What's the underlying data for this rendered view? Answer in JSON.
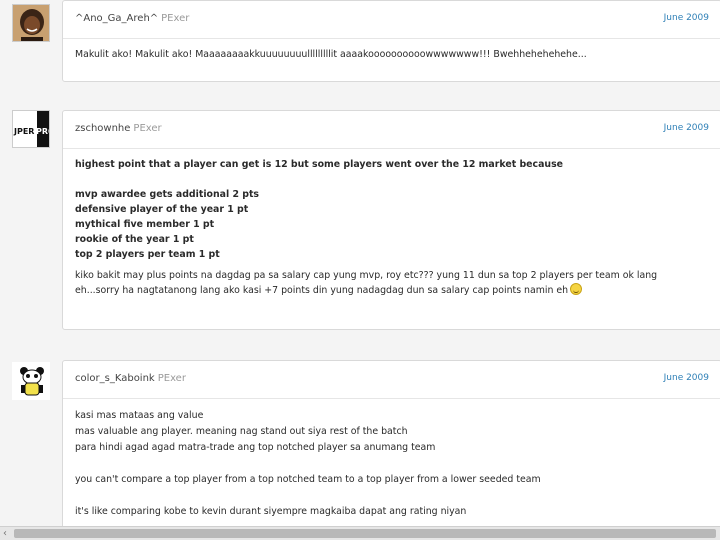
{
  "posts": [
    {
      "username": "^Ano_Ga_Areh^",
      "role": "PExer",
      "date": "June 2009",
      "avatar_icon": "user-photo-icon",
      "lines": [
        "Makulit ako! Makulit ako! Maaaaaaaakkuuuuuuuulllllllllit aaaakoooooooooowwwwwww!!! Bwehhehehehehe..."
      ]
    },
    {
      "username": "zschownhe",
      "role": "PExer",
      "date": "June 2009",
      "avatar_icon": "jperprox-logo-icon",
      "avatar_text": "JPERPROX",
      "bold_lines": [
        "highest point that a player can get is 12 but some players went over the 12 market because",
        "",
        "mvp awardee gets additional 2 pts",
        "defensive player of the year 1 pt",
        "mythical five member 1 pt",
        "rookie of the year 1 pt",
        "top 2 players per team 1 pt"
      ],
      "lines": [
        "kiko bakit may plus points na dagdag pa sa salary cap yung mvp, roy etc??? yung 11 dun sa top 2 players per team ok lang",
        "eh...sorry ha nagtatanong lang ako kasi +7 points din yung nadagdag dun sa salary cap points namin eh"
      ],
      "smiley_icon": "smiley-icon"
    },
    {
      "username": "color_s_Kaboink",
      "role": "PExer",
      "date": "June 2009",
      "avatar_icon": "panda-icon",
      "lines": [
        "kasi mas mataas ang value",
        "mas valuable ang player. meaning nag stand out siya rest of the batch",
        "para hindi agad agad matra-trade ang top notched player sa anumang team",
        "",
        "you can't compare a top player from a top notched team to a top player from a lower seeded team",
        "",
        "it's like comparing kobe to kevin durant siyempre magkaiba dapat ang rating niyan"
      ]
    }
  ],
  "scrollbar": {
    "left_arrow": "‹"
  }
}
